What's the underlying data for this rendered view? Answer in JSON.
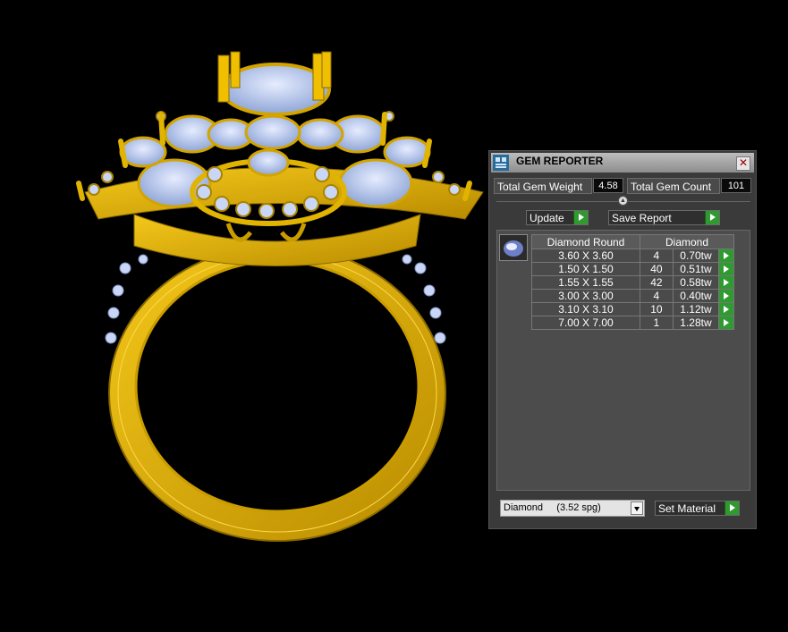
{
  "panel": {
    "title": "GEM REPORTER",
    "close_glyph": "✕",
    "icons": {
      "app": "gem-reporter-icon",
      "close": "close-icon",
      "collapse": "chevron-up-icon",
      "go": "play-arrow-icon",
      "dropdown": "chevron-down-icon",
      "gem": "round-diamond-icon"
    },
    "total_weight_label": "Total Gem Weight",
    "total_weight_value": "4.58",
    "total_count_label": "Total Gem Count",
    "total_count_value": "101",
    "update_label": "Update",
    "save_label": "Save Report",
    "table": {
      "col_shape": "Diamond Round",
      "col_material": "Diamond",
      "rows": [
        {
          "size": "3.60 X 3.60",
          "count": "4",
          "weight": "0.70tw"
        },
        {
          "size": "1.50 X 1.50",
          "count": "40",
          "weight": "0.51tw"
        },
        {
          "size": "1.55 X 1.55",
          "count": "42",
          "weight": "0.58tw"
        },
        {
          "size": "3.00 X 3.00",
          "count": "4",
          "weight": "0.40tw"
        },
        {
          "size": "3.10 X 3.10",
          "count": "10",
          "weight": "1.12tw"
        },
        {
          "size": "7.00 X 7.00",
          "count": "1",
          "weight": "1.28tw"
        }
      ]
    },
    "material_value": "Diamond     (3.52 spg)",
    "set_material_label": "Set Material"
  },
  "colors": {
    "gold": "#e0b400",
    "gem": "#b9c9f2",
    "background": "#000000",
    "go_button": "#2f9a2f"
  }
}
